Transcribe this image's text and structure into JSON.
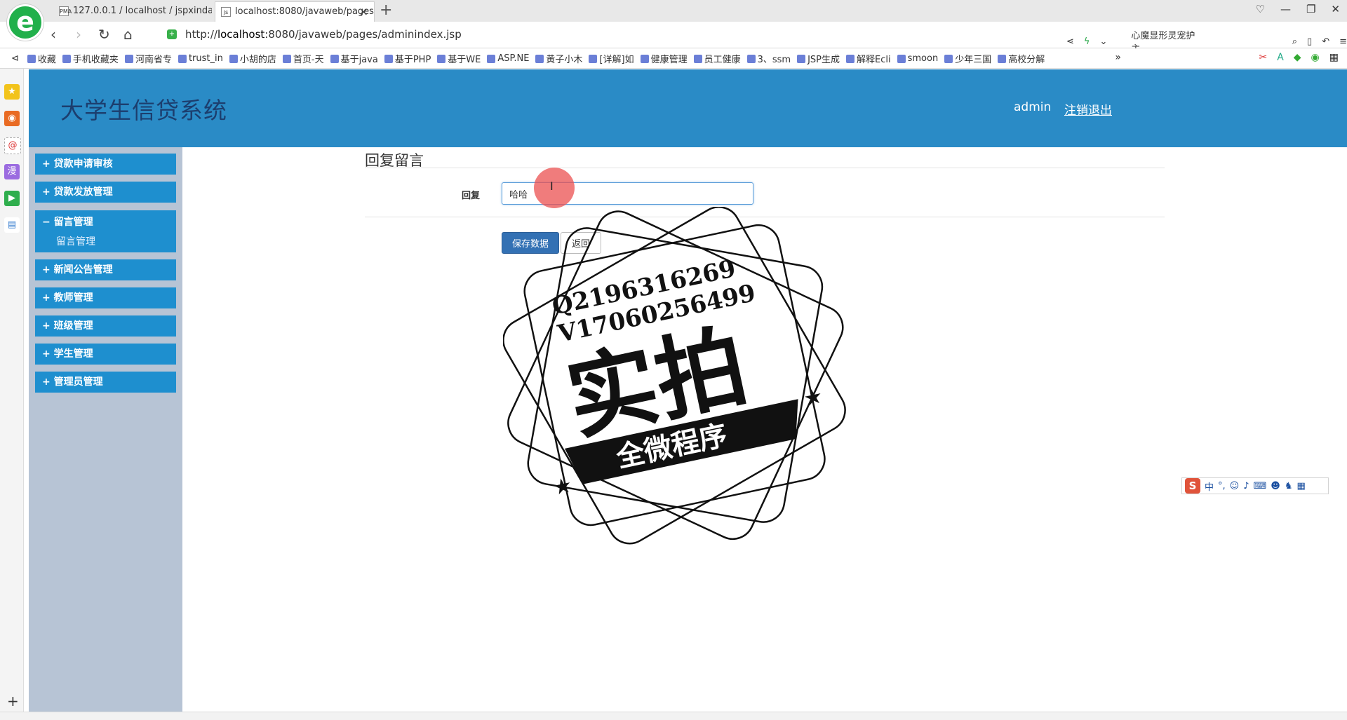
{
  "browser": {
    "tabs": [
      {
        "favicon": "PMA",
        "label": "127.0.0.1 / localhost / jspxinda"
      },
      {
        "favicon": "js",
        "label": "localhost:8080/javaweb/pages"
      }
    ],
    "new_tab": "+",
    "url_prefix": "http://",
    "url_host": "localhost",
    "url_rest": ":8080/javaweb/pages/adminindex.jsp",
    "search_text": "心魔显形灵宠护主",
    "bookmarks": [
      "收藏",
      "手机收藏夹",
      "河南省专",
      "trust_in",
      "小胡的店",
      "首页-天",
      "基于java",
      "基于PHP",
      "基于WE",
      "ASP.NE",
      "黄子小木",
      "[详解]如",
      "健康管理",
      "员工健康",
      "3、ssm",
      "JSP生成",
      "解释Ecli",
      "smoon",
      "少年三国",
      "高校分解"
    ],
    "bookmarks_more": "»",
    "logo": "e"
  },
  "app": {
    "title": "大学生信贷系统",
    "user": "admin",
    "logout": "注销退出"
  },
  "sidebar": {
    "items": [
      {
        "label": "+ 贷款申请审核"
      },
      {
        "label": "+ 贷款发放管理"
      },
      {
        "label": "− 留言管理",
        "sub": "留言管理"
      },
      {
        "label": "+ 新闻公告管理"
      },
      {
        "label": "+ 教师管理"
      },
      {
        "label": "+ 班级管理"
      },
      {
        "label": "+ 学生管理"
      },
      {
        "label": "+ 管理员管理"
      }
    ]
  },
  "form": {
    "title": "回复留言",
    "reply_label": "回复",
    "reply_value": "哈哈",
    "save_label": "保存数据",
    "back_label": "返回"
  },
  "watermark": {
    "line1": "Q2196316269",
    "line2": "V17060256499",
    "big": "实拍",
    "banner": "全微程序"
  },
  "ime": {
    "logo": "S",
    "mode": "中"
  },
  "colors": {
    "header": "#2a8bc6",
    "menu": "#1e8fcf",
    "sidebar": "#b7c4d5",
    "save": "#3371b4"
  }
}
